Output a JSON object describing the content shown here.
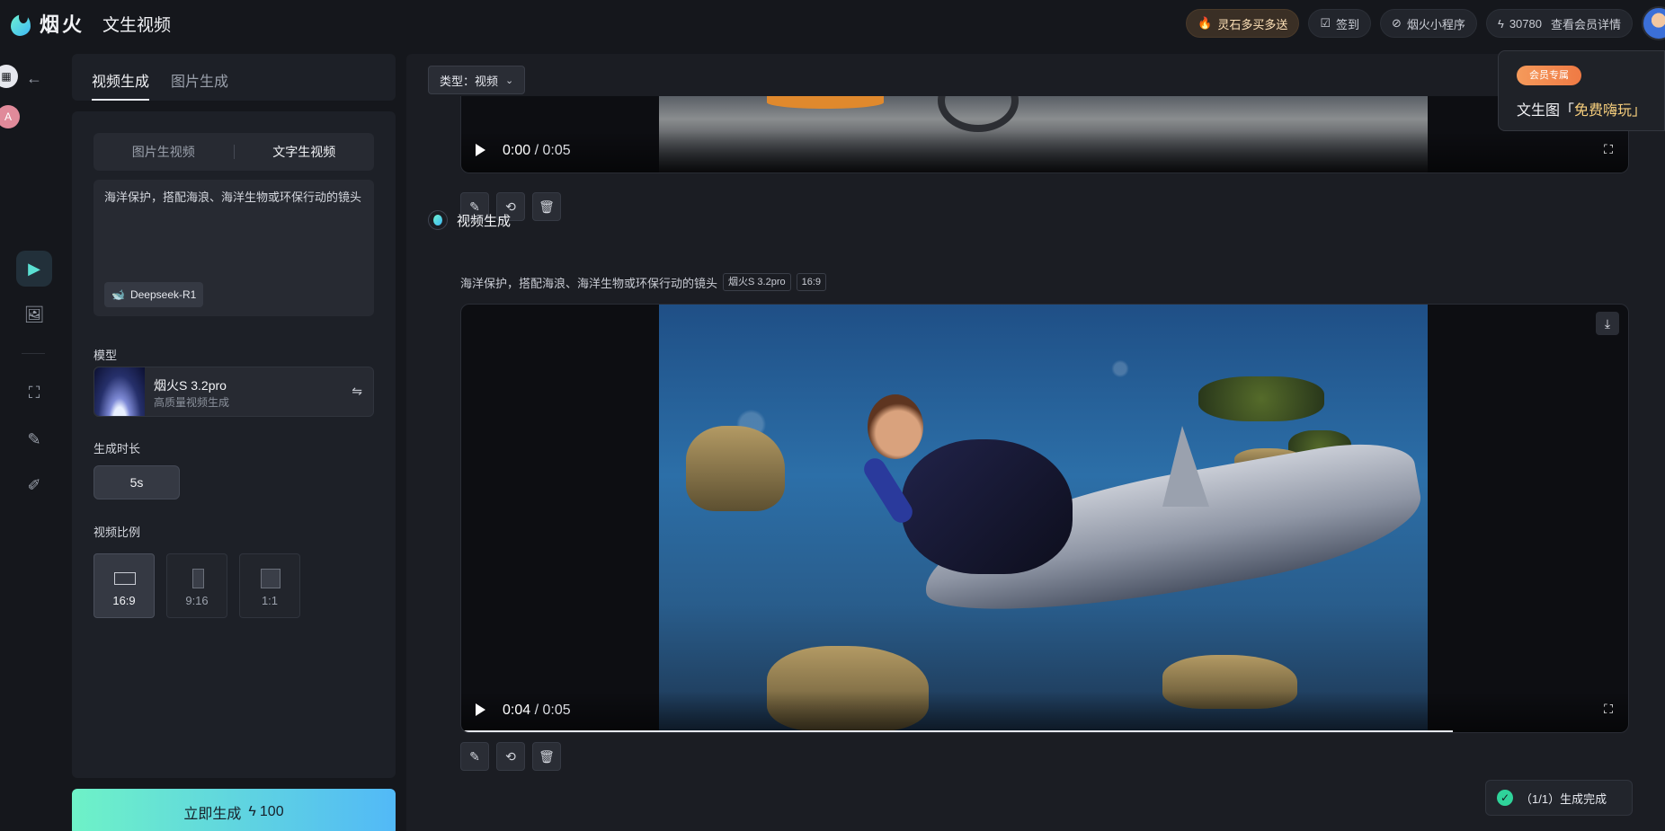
{
  "header": {
    "logo_text": "烟火",
    "page_title": "文生视频",
    "promo_label": "灵石多买多送",
    "checkin_label": "签到",
    "miniprogram_label": "烟火小程序",
    "points": "30780",
    "member_link": "查看会员详情"
  },
  "left_tabs": {
    "video_gen": "视频生成",
    "image_gen": "图片生成"
  },
  "mode_toggle": {
    "image_to_video": "图片生视频",
    "text_to_video": "文字生视频"
  },
  "prompt": {
    "text": "海洋保护，搭配海浪、海洋生物或环保行动的镜头",
    "model_chip": "Deepseek-R1"
  },
  "model_section": {
    "label": "模型",
    "name": "烟火S 3.2pro",
    "desc": "高质量视频生成"
  },
  "duration_section": {
    "label": "生成时长",
    "value": "5s"
  },
  "ratio_section": {
    "label": "视频比例",
    "options": [
      "16:9",
      "9:16",
      "1:1"
    ],
    "selected": "16:9"
  },
  "generate_button": {
    "label": "立即生成",
    "cost": "100"
  },
  "filter": {
    "type_label": "类型：视频"
  },
  "video_top": {
    "current_time": "0:00",
    "duration": "0:05",
    "progress": 0.0
  },
  "result": {
    "title": "视频生成",
    "prompt": "海洋保护，搭配海浪、海洋生物或环保行动的镜头",
    "model_tag": "烟火S 3.2pro",
    "ratio_tag": "16:9",
    "current_time": "0:04",
    "duration": "0:05",
    "progress": 0.85
  },
  "popup": {
    "tag": "会员专属",
    "text_prefix": "文生图「",
    "text_highlight": "免费嗨玩",
    "text_suffix": "」"
  },
  "toast": {
    "text": "（1/1）生成完成"
  },
  "colors": {
    "accent": "#5be0d3",
    "background": "#15171c",
    "panel": "#1d2027",
    "success": "#2fd39a"
  }
}
